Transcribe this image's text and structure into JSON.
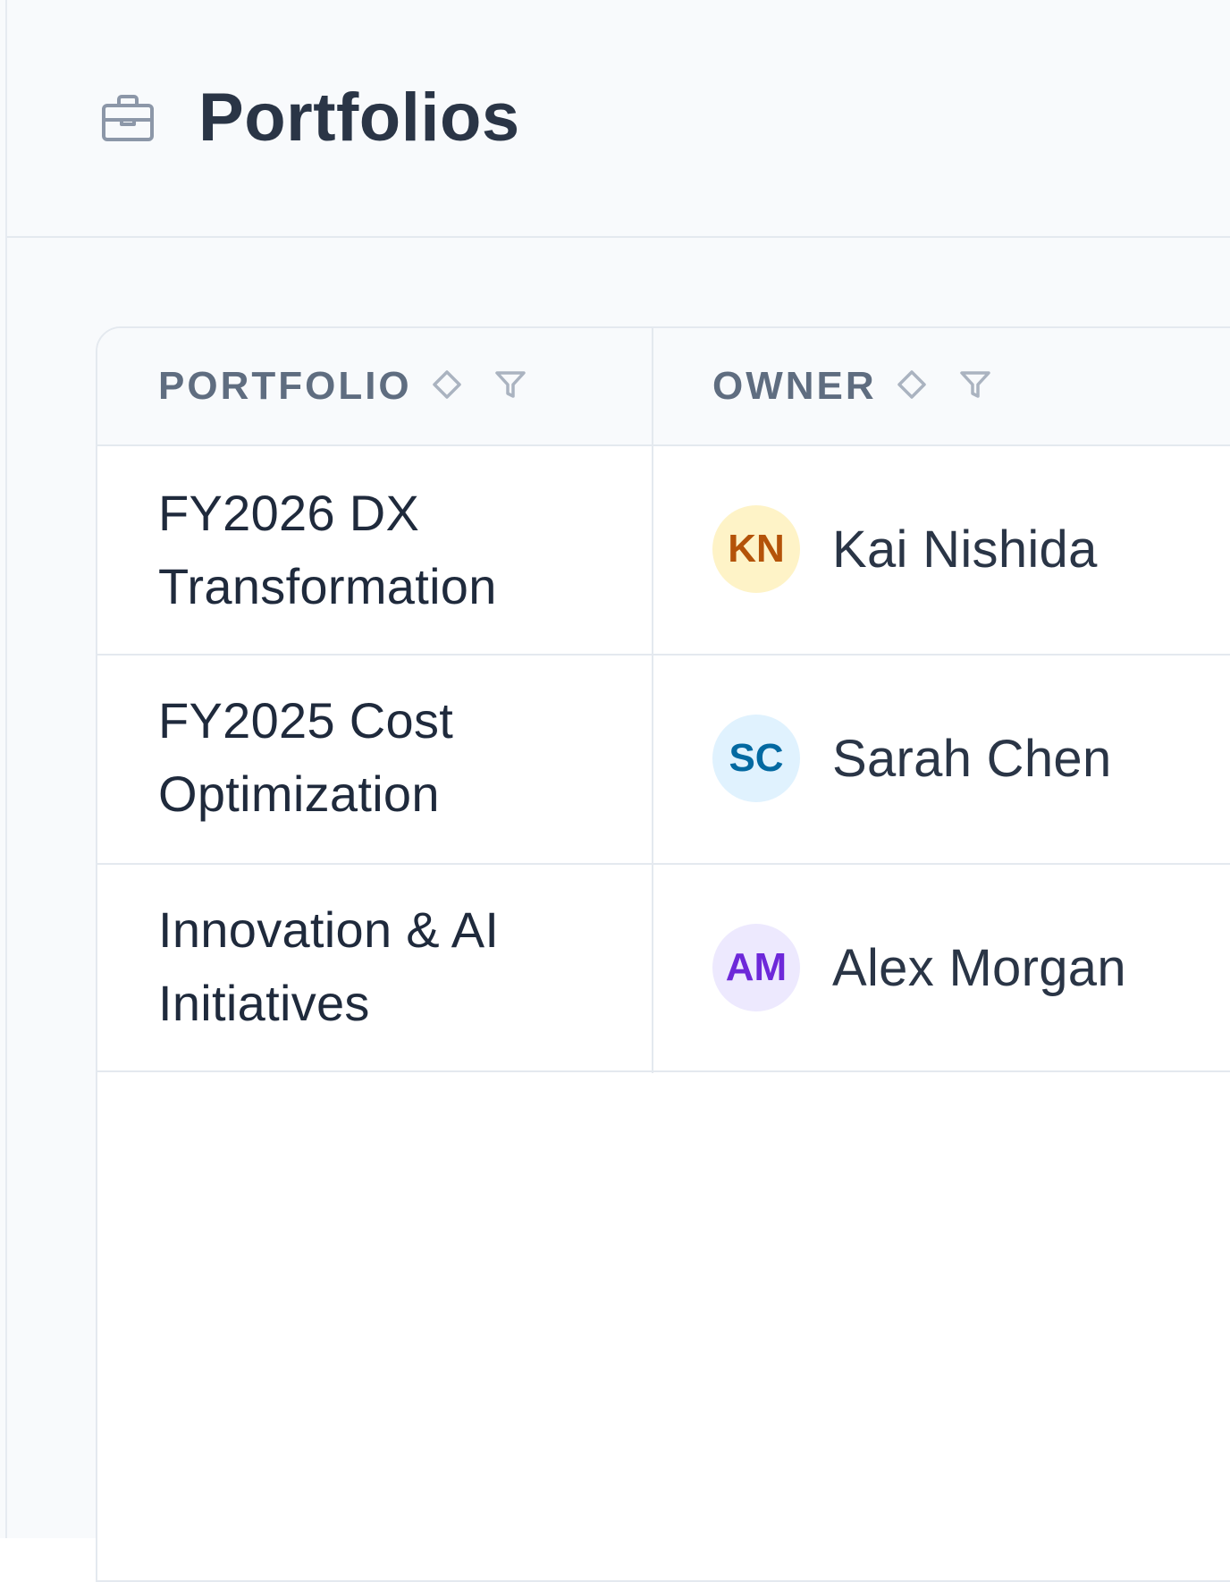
{
  "header": {
    "title": "Portfolios",
    "icon": "briefcase-icon"
  },
  "table": {
    "columns": [
      {
        "label": "PORTFOLIO",
        "sort_icon": "sort-icon",
        "filter_icon": "filter-icon"
      },
      {
        "label": "OWNER",
        "sort_icon": "sort-icon",
        "filter_icon": "filter-icon"
      }
    ],
    "rows": [
      {
        "name_line1": "FY2026 DX",
        "name_line2": "Transformation",
        "owner_initials": "KN",
        "owner_name": "Kai Nishida",
        "avatar_bg": "#fef3c7",
        "avatar_fg": "#b45309"
      },
      {
        "name_line1": "FY2025 Cost",
        "name_line2": "Optimization",
        "owner_initials": "SC",
        "owner_name": "Sarah Chen",
        "avatar_bg": "#e0f2fe",
        "avatar_fg": "#0369a1"
      },
      {
        "name_line1": "Innovation & AI",
        "name_line2": "Initiatives",
        "owner_initials": "AM",
        "owner_name": "Alex Morgan",
        "avatar_bg": "#ede9fe",
        "avatar_fg": "#6d28d9"
      }
    ]
  },
  "colors": {
    "background": "#f8fafc",
    "border": "#e4e9ef",
    "header_text": "#5f6d80",
    "title_text": "#2a3546"
  }
}
